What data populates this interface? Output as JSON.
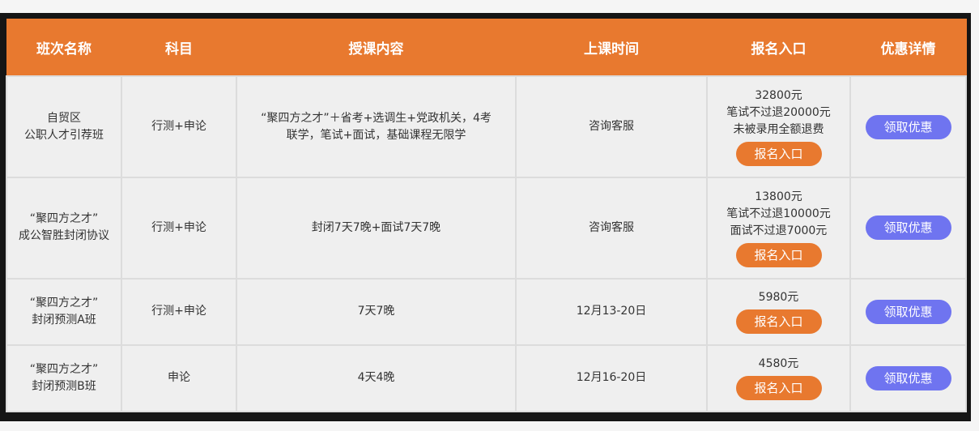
{
  "table": {
    "headers": [
      "班次名称",
      "科目",
      "授课内容",
      "上课时间",
      "报名入口",
      "优惠详情"
    ],
    "rows": [
      {
        "name": [
          "自贸区",
          "公职人才引荐班"
        ],
        "subject": "行测+申论",
        "content": [
          "“聚四方之才”＋省考+选调生+党政机关，4考",
          "联学，笔试+面试，基础课程无限学"
        ],
        "time": "咨询客服",
        "price": [
          "32800元",
          "笔试不过退20000元",
          "未被录用全额退费"
        ],
        "enroll_label": "报名入口",
        "promo_label": "领取优惠"
      },
      {
        "name": [
          "“聚四方之才”",
          "成公智胜封闭协议"
        ],
        "subject": "行测+申论",
        "content": [
          "封闭7天7晚+面试7天7晚"
        ],
        "time": "咨询客服",
        "price": [
          "13800元",
          "笔试不过退10000元",
          "面试不过退7000元"
        ],
        "enroll_label": "报名入口",
        "promo_label": "领取优惠"
      },
      {
        "name": [
          "“聚四方之才”",
          "封闭预测A班"
        ],
        "subject": "行测+申论",
        "content": [
          "7天7晚"
        ],
        "time": "12月13-20日",
        "price": [
          "5980元"
        ],
        "enroll_label": "报名入口",
        "promo_label": "领取优惠"
      },
      {
        "name": [
          "“聚四方之才”",
          "封闭预测B班"
        ],
        "subject": "申论",
        "content": [
          "4天4晚"
        ],
        "time": "12月16-20日",
        "price": [
          "4580元"
        ],
        "enroll_label": "报名入口",
        "promo_label": "领取优惠"
      }
    ]
  },
  "colors": {
    "header_bg": "#e8792f",
    "enroll_button": "#e8792f",
    "promo_button": "#6f74f0",
    "frame": "#151515",
    "cell_bg": "#efefef"
  }
}
